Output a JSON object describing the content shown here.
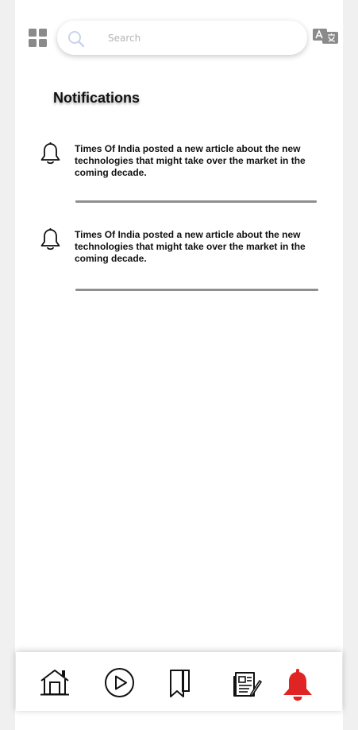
{
  "header": {
    "menu_icon": "grid-menu-icon",
    "search": {
      "placeholder": "Search",
      "icon": "search-icon"
    },
    "translate_icon": "translate-icon"
  },
  "page": {
    "title": "Notifications"
  },
  "notifications": [
    {
      "icon": "bell-icon",
      "text": "Times Of India posted a new article about the new technologies that might take over the market in the coming decade."
    },
    {
      "icon": "bell-icon",
      "text": "Times Of India posted a new article about the new technologies that might take over the market in the coming decade."
    }
  ],
  "bottom_nav": {
    "items": [
      {
        "name": "home",
        "icon": "home-icon"
      },
      {
        "name": "videos",
        "icon": "play-icon"
      },
      {
        "name": "bookmarks",
        "icon": "bookmark-icon"
      },
      {
        "name": "news",
        "icon": "newspaper-icon"
      },
      {
        "name": "notifications",
        "icon": "bell-icon",
        "active": true
      }
    ],
    "active_color": "#e02424"
  },
  "colors": {
    "icon_gray": "#8a8a8a",
    "search_icon": "#c9d3ea",
    "divider": "#8f8f8f"
  }
}
